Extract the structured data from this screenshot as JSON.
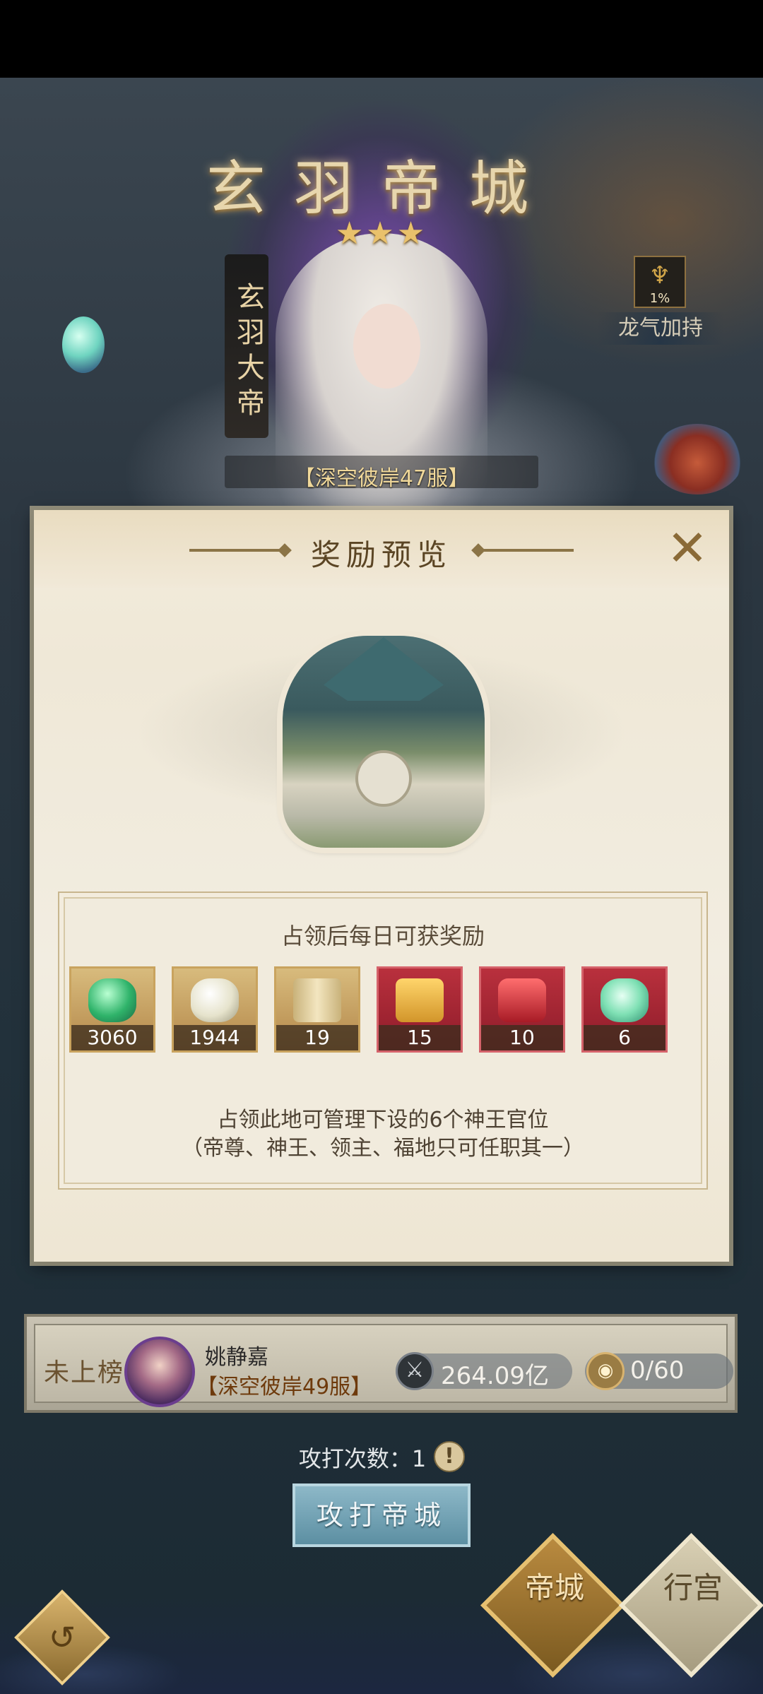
{
  "header": {
    "city_title": "玄羽帝城",
    "stars": "★★★",
    "emperor_title": "玄羽大帝",
    "server_tag": "【深空彼岸47服】"
  },
  "side": {
    "dragon_percent": "1%",
    "dragon_label": "龙气加持",
    "dragon_icon": "dragon-emblem-icon",
    "reward_preview_icon": "treasure-chest-icon"
  },
  "modal": {
    "title": "奖励预览",
    "close_icon": "close-x-icon",
    "rewards_heading": "占领后每日可获奖励",
    "items": [
      {
        "count": "3060",
        "icon": "green-gem-icon",
        "frame": "gold",
        "color": "#2fb36a"
      },
      {
        "count": "1944",
        "icon": "silver-feather-icon",
        "frame": "gold",
        "color": "#e6e3cc"
      },
      {
        "count": "19",
        "icon": "scroll-icon",
        "frame": "gold",
        "color": "#e8d9a8"
      },
      {
        "count": "15",
        "icon": "gold-chest-icon",
        "frame": "red",
        "color": "#e2a53a"
      },
      {
        "count": "10",
        "icon": "red-talisman-icon",
        "frame": "red",
        "color": "#d73a3a"
      },
      {
        "count": "6",
        "icon": "jade-orb-icon",
        "frame": "red",
        "color": "#7fe0b4"
      }
    ],
    "desc_line1": "占领此地可管理下设的6个神王官位",
    "desc_line2": "（帝尊、神王、领主、福地只可任职其一）"
  },
  "occupant": {
    "rank_label": "未上榜",
    "name": "姚静嘉",
    "server": "【深空彼岸49服】",
    "power": "264.09亿",
    "slots": "0/60"
  },
  "attack": {
    "count_text": "攻打次数：1",
    "info_icon": "!",
    "button_label": "攻打帝城"
  },
  "nav": {
    "back_icon": "back-swirl-icon",
    "tab_city": "帝城",
    "tab_palace": "行宫"
  },
  "colors": {
    "modal_bg": "#f2ede1",
    "accent_gold": "#c9a35e",
    "attack_button": "#5c8fa2"
  }
}
